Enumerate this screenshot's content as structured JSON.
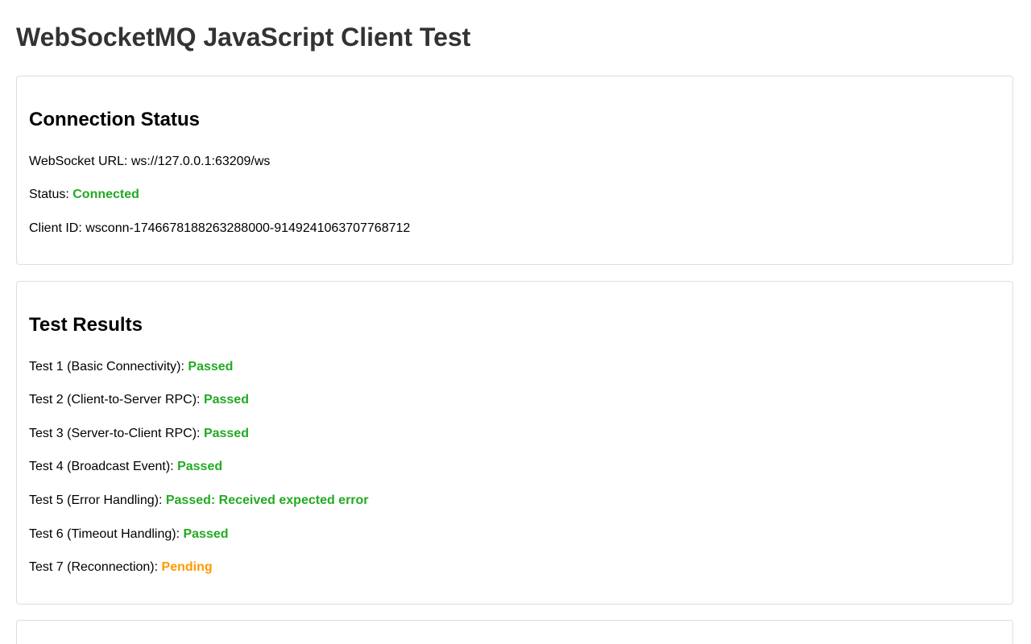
{
  "page": {
    "title": "WebSocketMQ JavaScript Client Test"
  },
  "connection": {
    "heading": "Connection Status",
    "url_label": "WebSocket URL: ",
    "url_value": "ws://127.0.0.1:63209/ws",
    "status_label": "Status: ",
    "status_value": "Connected",
    "client_id_label": "Client ID: ",
    "client_id_value": "wsconn-1746678188263288000-9149241063707768712"
  },
  "tests": {
    "heading": "Test Results",
    "items": [
      {
        "label": "Test 1 (Basic Connectivity): ",
        "result": "Passed",
        "state": "passed"
      },
      {
        "label": "Test 2 (Client-to-Server RPC): ",
        "result": "Passed",
        "state": "passed"
      },
      {
        "label": "Test 3 (Server-to-Client RPC): ",
        "result": "Passed",
        "state": "passed"
      },
      {
        "label": "Test 4 (Broadcast Event): ",
        "result": "Passed",
        "state": "passed"
      },
      {
        "label": "Test 5 (Error Handling): ",
        "result": "Passed: Received expected error",
        "state": "passed"
      },
      {
        "label": "Test 6 (Timeout Handling): ",
        "result": "Passed",
        "state": "passed"
      },
      {
        "label": "Test 7 (Reconnection): ",
        "result": "Pending",
        "state": "pending"
      }
    ]
  },
  "colors": {
    "passed": "#22aa22",
    "pending": "#ff9900",
    "title": "#333333",
    "panel_border": "#dddddd"
  }
}
